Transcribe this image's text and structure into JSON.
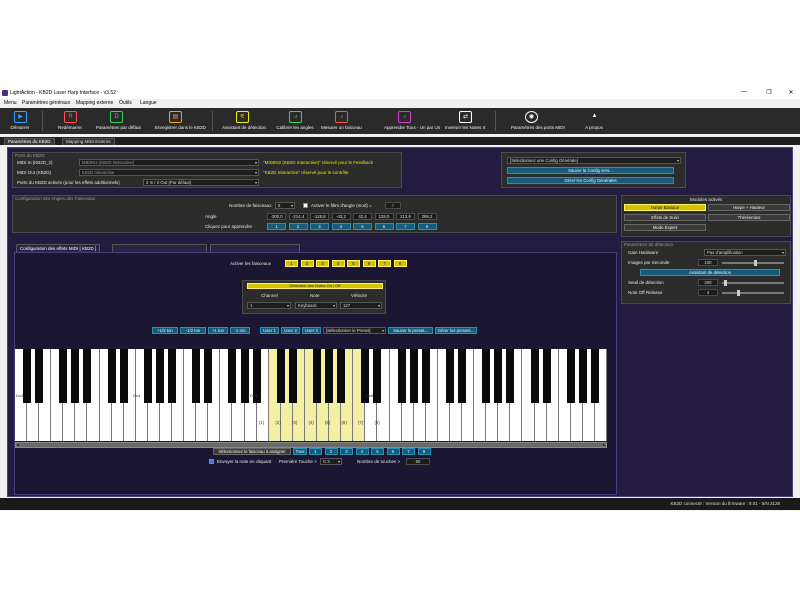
{
  "window": {
    "title": "LightAction - KB2D Laser Harp Interface - v3.52",
    "controls": [
      "—",
      "❐",
      "✕"
    ]
  },
  "menu": [
    "Menu",
    "Paramètres généraux",
    "Mapping externe",
    "Outils",
    "Langue"
  ],
  "toolbar": [
    {
      "label": "Démarrer",
      "icon": "play-icon",
      "color": "#3aa0ff",
      "glyph": "▶"
    },
    {
      "label": "Redémarrer",
      "icon": "restart-icon",
      "color": "#ff5050",
      "glyph": "R"
    },
    {
      "label": "Paramètres par défaut",
      "icon": "defaults-icon",
      "color": "#40d060",
      "glyph": "D"
    },
    {
      "label": "Enregistrer dans le KB2D",
      "icon": "save-icon",
      "color": "#f0a020",
      "glyph": "▤"
    },
    {
      "label": "Assistant de détection",
      "icon": "detection-assistant-icon",
      "color": "#f0f000",
      "glyph": "⚟"
    },
    {
      "label": "Calibrer les angles",
      "icon": "calibrate-angles-icon",
      "color": "#40d060",
      "glyph": "⩘"
    },
    {
      "label": "Mesurer un faisceau",
      "icon": "measure-beam-icon",
      "color": "#ff5050",
      "glyph": "⩘"
    },
    {
      "label": "Apprendre Tous - Un par Un",
      "icon": "learn-all-icon",
      "color": "#d040d0",
      "glyph": "⩘"
    },
    {
      "label": "Inverser les Notes X",
      "icon": "invert-notes-icon",
      "color": "#ffffff",
      "glyph": "⇄"
    },
    {
      "label": "Paramètres des ports MIDI",
      "icon": "midi-ports-icon",
      "color": "#ffffff",
      "glyph": "◉"
    },
    {
      "label": "A propos",
      "icon": "about-icon",
      "color": "#ffffff",
      "glyph": "▲"
    }
  ],
  "tabs": [
    "Paramètres du KB2D",
    "Mapping MIDI Externe"
  ],
  "ports": {
    "title": "Ports du KB2D",
    "midi_in_label": "MIDI In (KB2D_2)",
    "midi_in_value": "MIDIIN2 (KB2D Interactive)",
    "midi_in_note": "\"MIDIIN2 (KB2D Interactive)\" réservé pour le Feedback",
    "midi_out_label": "MIDI Out (KB2D)",
    "midi_out_value": "KB2D Interactive",
    "midi_out_note": "\"KB2D Interactive\" réservé pour le contrôle",
    "effects_ports_label": "Ports du KB2D activés (pour les effets additionnels)",
    "effects_ports_value": "2 In / 2 Out (Par défaut)"
  },
  "config": {
    "select_value": "[Sélectionnez une Config Générale]",
    "save_btn": "Sauver la Config vers...",
    "manage_btn": "Gérer les Config Générales"
  },
  "beams": {
    "title": "Configuration des Angles des Faisceaux",
    "count_label": "Nombre de faisceaux",
    "count_value": "8",
    "filter_label": "Activer le filtre d'angle (mod) =",
    "filter_value": "0",
    "angle_label": "Angle",
    "angles": [
      "-300,0",
      "-214,4",
      "-128,8",
      "-43,2",
      "42,4",
      "128,0",
      "213,6",
      "299,2"
    ],
    "learn_label": "Cliquez pour apprendre",
    "learn_buttons": [
      "1",
      "2",
      "3",
      "4",
      "5",
      "6",
      "7",
      "8"
    ]
  },
  "modules": {
    "title": "Modules activés",
    "items": [
      {
        "label": "Harpe Basique",
        "active": true
      },
      {
        "label": "Harpe + Hauteur",
        "active": false
      },
      {
        "label": "Effets de Suivi",
        "active": false
      },
      {
        "label": "Théréemins",
        "active": false
      },
      {
        "label": "Mode Expert",
        "active": false
      }
    ]
  },
  "detection": {
    "title": "Paramètres de détection",
    "gain_label": "Gain Hardware",
    "gain_value": "Pas d'amplification",
    "fps_label": "Images par Seconde",
    "fps_value": "100",
    "fps_level": 0.55,
    "assistant_btn": "Assistant de détection",
    "threshold_label": "Seuil de détection",
    "threshold_value": "200",
    "threshold_level": 0.03,
    "noteoff_label": "Note Off Release",
    "noteoff_value": "4",
    "noteoff_level": 0.25
  },
  "effect_tabs": [
    "Configuration des effets MIDI [ KB2D ]",
    "",
    ""
  ],
  "activate_beams": {
    "label": "Activer les faisceaux",
    "buttons": [
      "1",
      "2",
      "3",
      "4",
      "5",
      "6",
      "7",
      "8"
    ]
  },
  "note_panel": {
    "header": "Détection des Notes On / Off",
    "channel_label": "Channel",
    "note_label": "Note",
    "velocity_label": "Vélocité",
    "channel_value": "1",
    "note_value": "Keyboard",
    "velocity_value": "127"
  },
  "transpose_buttons": [
    "+1/2 ton",
    "-1/2 ton",
    "+1 ton",
    "-1 ton"
  ],
  "user_buttons": [
    "User 1",
    "User 2",
    "User 3"
  ],
  "preset_select": "[Sélectionner le Preset]",
  "save_preset_btn": "Sauver le preset...",
  "manage_presets_btn": "Gérer les presets...",
  "keyboard": {
    "octave_labels": [
      "Do3",
      "Do4",
      "Do5",
      "Do6"
    ],
    "beam_labels": [
      "(1)",
      "(2)",
      "(3)",
      "(4)",
      "(5)",
      "(6)",
      "(7)",
      "(8)"
    ]
  },
  "assign": {
    "label": "Sélectionnez le faisceau à assigner",
    "all_btn": "Tous",
    "buttons": [
      "1",
      "2",
      "3",
      "4",
      "5",
      "6",
      "7",
      "8"
    ],
    "send_note_label": "Envoyer la note en cliquant",
    "first_key_label": "Première Touche >",
    "first_key_value": "C 3",
    "num_keys_label": "Nombre de touches >",
    "num_keys_value": "60"
  },
  "status": "KB2D connecté : Version du firmware : 8.01 - 5/N 3126"
}
